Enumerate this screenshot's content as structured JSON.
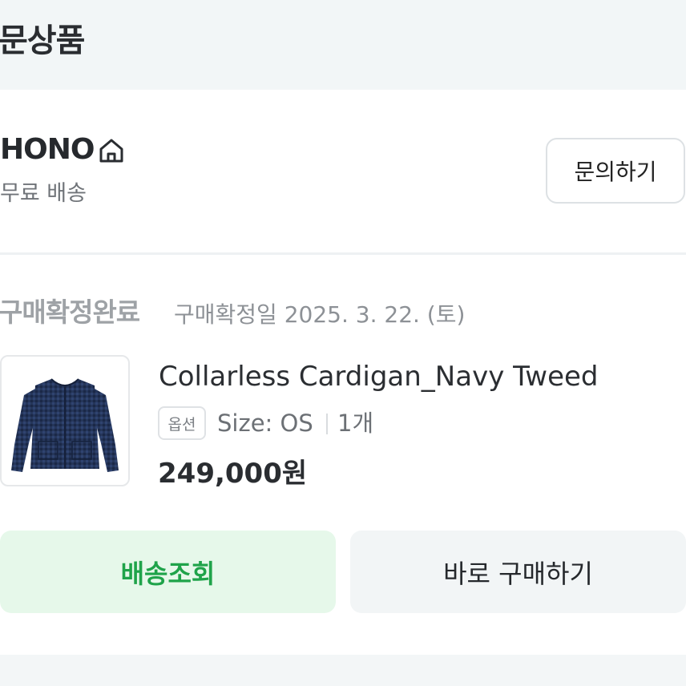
{
  "header": {
    "title": "문상품"
  },
  "seller": {
    "name": "HONO",
    "shipping": "무료 배송",
    "inquiry_label": "문의하기"
  },
  "order": {
    "status": "구매확정완료",
    "date_text": "구매확정일 2025. 3. 22. (토)",
    "product": {
      "name": "Collarless Cardigan_Navy Tweed",
      "option_badge": "옵션",
      "size": "Size: OS",
      "quantity": "1개",
      "price": "249,000원",
      "image_icon": "navy-cardigan-image"
    }
  },
  "actions": {
    "track_label": "배송조회",
    "buy_again_label": "바로 구매하기"
  },
  "colors": {
    "track_bg": "#e6f8ea",
    "track_text": "#1fa34a",
    "status_gray": "#9ea2a6"
  }
}
